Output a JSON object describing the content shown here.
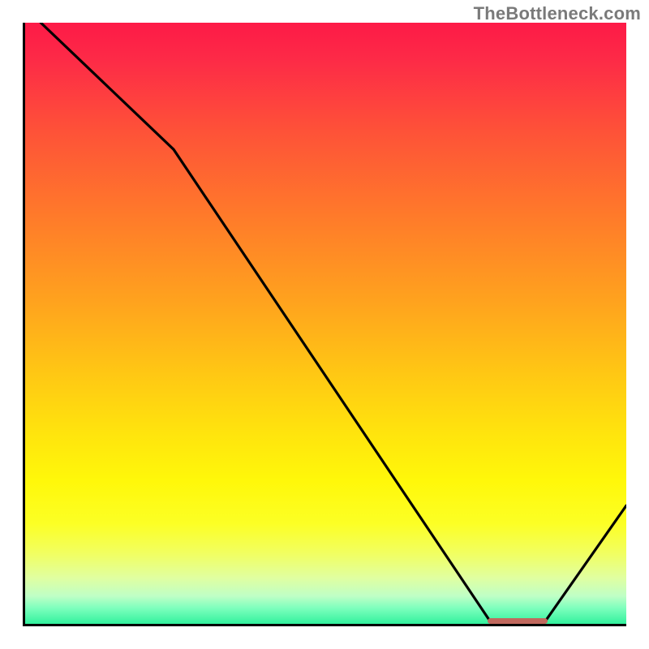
{
  "attribution": "TheBottleneck.com",
  "chart_data": {
    "type": "line",
    "title": "",
    "xlabel": "",
    "ylabel": "",
    "x_range": [
      0,
      100
    ],
    "y_range": [
      0,
      100
    ],
    "x": [
      3,
      25,
      78,
      86,
      100
    ],
    "values": [
      100,
      79,
      0,
      0,
      20
    ],
    "trough_span": [
      77,
      87
    ],
    "gradient_stops": [
      {
        "pos": 0,
        "color": "#fd1a47"
      },
      {
        "pos": 18,
        "color": "#fe5238"
      },
      {
        "pos": 46,
        "color": "#ffa21e"
      },
      {
        "pos": 68,
        "color": "#ffe40d"
      },
      {
        "pos": 88,
        "color": "#f1ff62"
      },
      {
        "pos": 100,
        "color": "#27ef98"
      }
    ],
    "marker_color": "#c1695e"
  }
}
